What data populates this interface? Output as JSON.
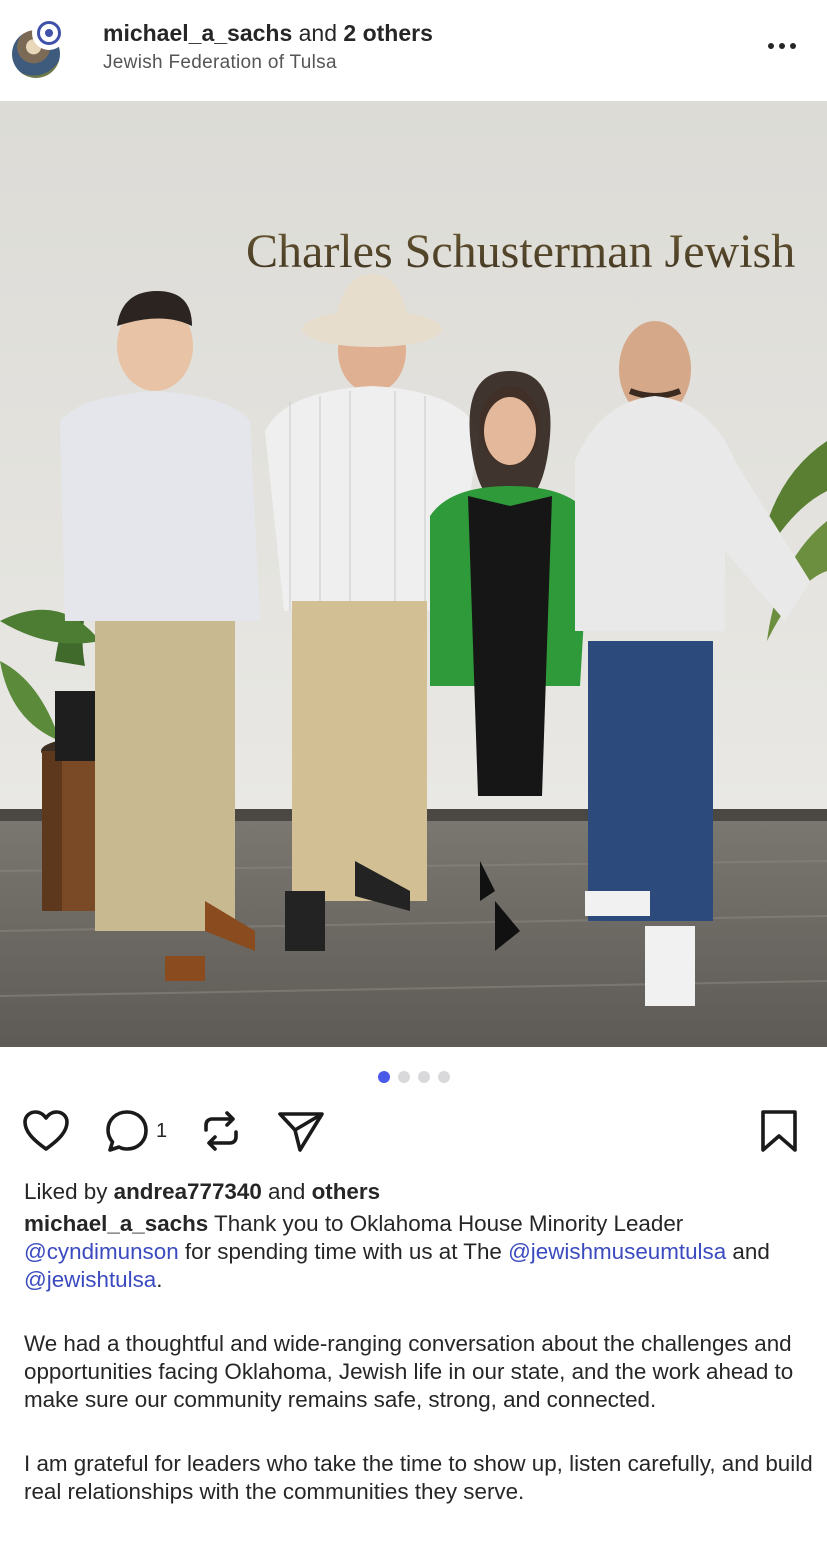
{
  "header": {
    "username": "michael_a_sachs",
    "collab_text": " and ",
    "others": "2 others",
    "location": "Jewish Federation of Tulsa"
  },
  "photo": {
    "sign_text": "Charles Schusterman Jewish"
  },
  "pager": {
    "total": 4,
    "active_index": 0
  },
  "actions": {
    "comment_count": "1"
  },
  "likes": {
    "prefix": "Liked by ",
    "user": "andrea777340",
    "middle": " and ",
    "others": "others"
  },
  "caption": {
    "author": "michael_a_sachs",
    "p1_a": " Thank you to Oklahoma House Minority Leader ",
    "mention1": "@cyndimunson",
    "p1_b": " for spending time with us at The ",
    "mention2": "@jewishmuseumtulsa",
    "p1_c": " and ",
    "mention3": "@jewishtulsa",
    "p1_d": ".",
    "p2": "We had a thoughtful and wide-ranging conversation about the challenges and opportunities facing Oklahoma, Jewish life in our state, and the work ahead to make sure our community remains safe, strong, and connected.",
    "p3": "I am grateful for leaders who take the time to show up, listen carefully, and build real relationships with the communities they serve."
  },
  "colors": {
    "accent": "#4a5ae8",
    "mention": "#3b4bbf",
    "text": "#262626"
  }
}
